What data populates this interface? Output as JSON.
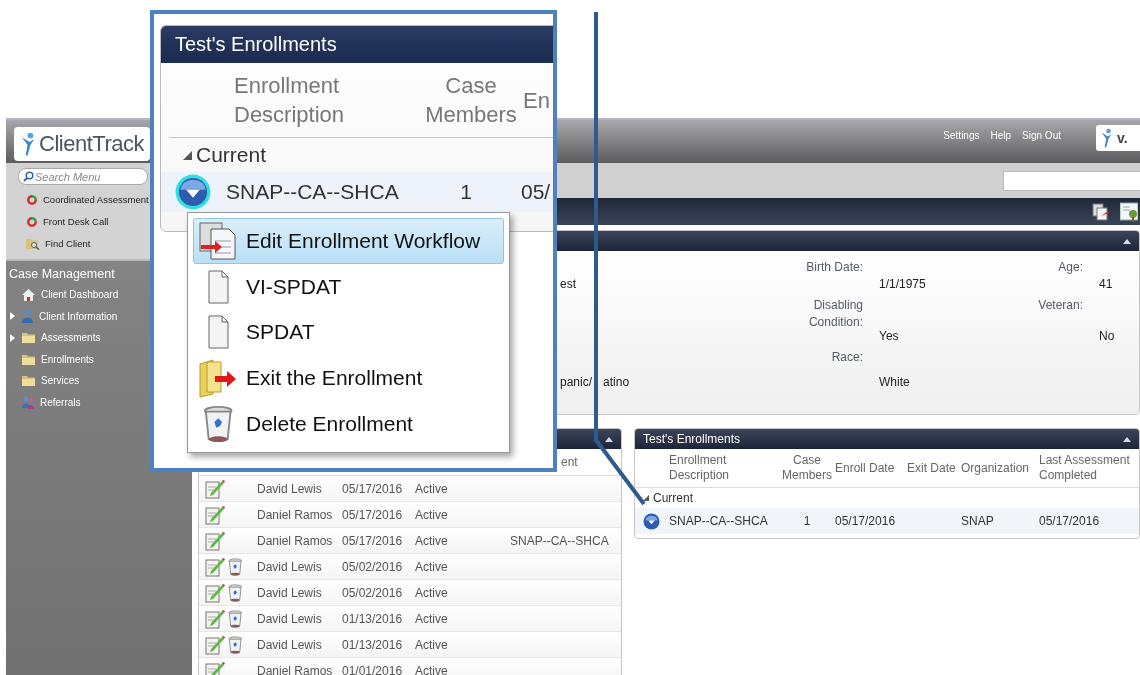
{
  "header": {
    "logo": "ClientTrack",
    "links": [
      "Settings",
      "Help",
      "Sign Out"
    ],
    "version_logo": "v."
  },
  "sidebar": {
    "search_placeholder": "Search Menu",
    "quick_items": [
      {
        "label": "Coordinated Assessment",
        "kind": "cycle"
      },
      {
        "label": "Front Desk Call",
        "kind": "cycle"
      },
      {
        "label": "Find Client",
        "kind": "find"
      }
    ],
    "section": "Case Management",
    "items": [
      {
        "label": "Client Dashboard",
        "kind": "home",
        "expandable": false
      },
      {
        "label": "Client Information",
        "kind": "person",
        "expandable": true
      },
      {
        "label": "Assessments",
        "kind": "folder",
        "expandable": true
      },
      {
        "label": "Enrollments",
        "kind": "folder",
        "expandable": false
      },
      {
        "label": "Services",
        "kind": "folder",
        "expandable": false
      },
      {
        "label": "Referrals",
        "kind": "people",
        "expandable": false
      }
    ]
  },
  "client_panel": {
    "rows": [
      {
        "left": "est",
        "fields": [
          {
            "label": "Birth Date:",
            "value": "1/1/1975"
          },
          {
            "label": "Age:",
            "value": "41"
          }
        ]
      },
      {
        "fields": [
          {
            "label": "Disabling Condition:",
            "value": "Yes"
          },
          {
            "label": "Veteran:",
            "value": "No"
          }
        ]
      },
      {
        "left": "panic/",
        "left_after_line": "atino",
        "fields": [
          {
            "label": "Race:",
            "value": "White"
          }
        ]
      }
    ]
  },
  "history_table": {
    "visible_header": "ent",
    "rows": [
      {
        "name": "David Lewis",
        "date": "05/17/2016",
        "status": "Active",
        "deletable": false
      },
      {
        "name": "Daniel Ramos",
        "date": "05/17/2016",
        "status": "Active",
        "deletable": false
      },
      {
        "name": "Daniel Ramos",
        "date": "05/17/2016",
        "status": "Active",
        "enrollment": "SNAP--CA--SHCA",
        "deletable": false
      },
      {
        "name": "David Lewis",
        "date": "05/02/2016",
        "status": "Active",
        "deletable": true
      },
      {
        "name": "David Lewis",
        "date": "05/02/2016",
        "status": "Active",
        "deletable": true
      },
      {
        "name": "David Lewis",
        "date": "01/13/2016",
        "status": "Active",
        "deletable": true
      },
      {
        "name": "David Lewis",
        "date": "01/13/2016",
        "status": "Active",
        "deletable": true
      },
      {
        "name": "Daniel Ramos",
        "date": "01/01/2016",
        "status": "Active",
        "deletable": false
      }
    ]
  },
  "enrollments_panel": {
    "title": "Test's Enrollments",
    "columns": [
      "Enrollment Description",
      "Case Members",
      "Enroll Date",
      "Exit Date",
      "Organization",
      "Last Assessment Completed"
    ],
    "group": {
      "label": "Current",
      "expanded": true
    },
    "rows": [
      {
        "cells": [
          "SNAP--CA--SHCA",
          "1",
          "05/17/2016",
          "",
          "SNAP",
          "05/17/2016"
        ]
      }
    ]
  },
  "callout": {
    "title": "Test's Enrollments",
    "columns": [
      "Enrollment Description",
      "Case Members",
      "En"
    ],
    "group": {
      "label": "Current",
      "expanded": true
    },
    "row": {
      "cells": [
        "SNAP--CA--SHCA",
        "1",
        "05/"
      ]
    },
    "menu": [
      {
        "label": "Edit Enrollment Workflow",
        "kind": "workflow",
        "selected": true
      },
      {
        "label": "VI-SPDAT",
        "kind": "form",
        "selected": false
      },
      {
        "label": "SPDAT",
        "kind": "form",
        "selected": false
      },
      {
        "label": "Exit the Enrollment",
        "kind": "exit",
        "selected": false
      },
      {
        "label": "Delete Enrollment",
        "kind": "delete",
        "selected": false
      }
    ]
  }
}
